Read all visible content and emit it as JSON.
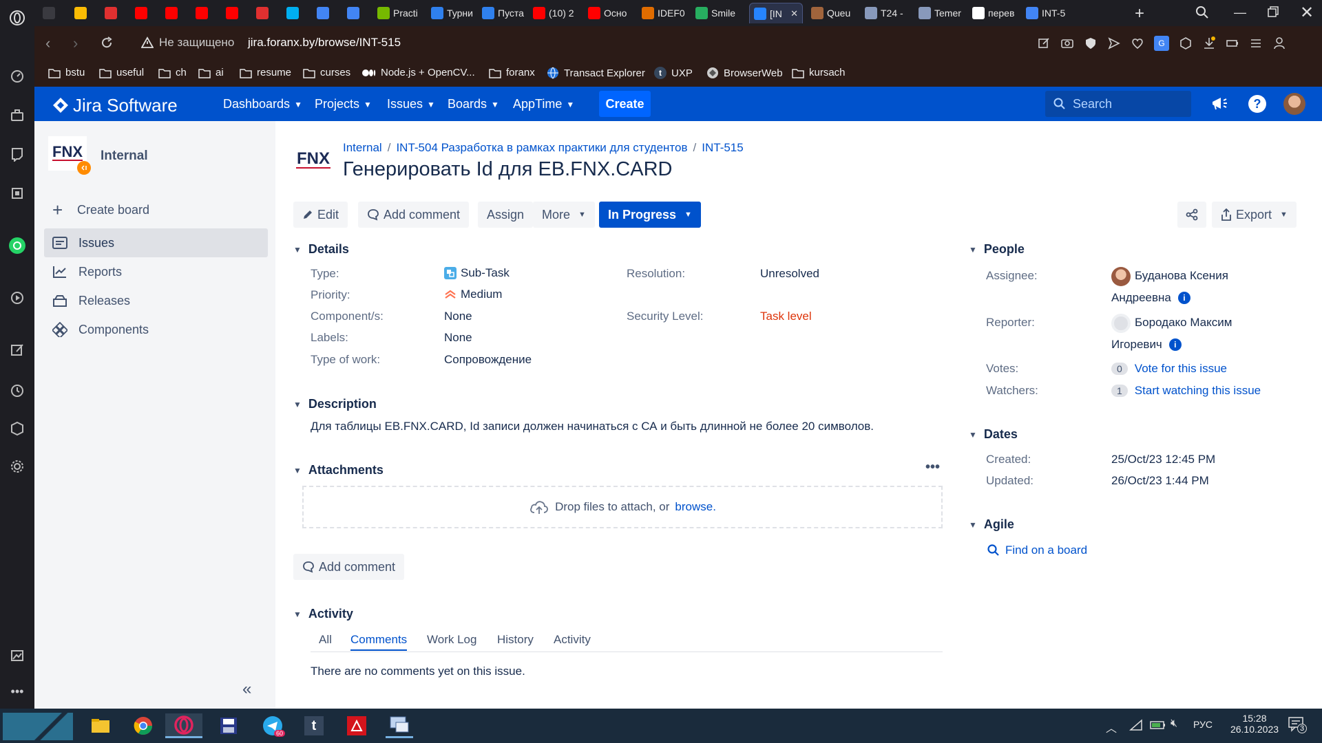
{
  "browser": {
    "tabs": [
      {
        "label": "",
        "icon": "gamepad-icon",
        "color": "#3a3a40"
      },
      {
        "label": "",
        "icon": "google-drive-icon",
        "color": "#fbbc04"
      },
      {
        "label": "",
        "icon": "cherry-icon",
        "color": "#e03030"
      },
      {
        "label": "",
        "icon": "youtube-icon",
        "color": "#ff0000"
      },
      {
        "label": "",
        "icon": "youtube-icon",
        "color": "#ff0000"
      },
      {
        "label": "",
        "icon": "youtube-icon",
        "color": "#ff0000"
      },
      {
        "label": "",
        "icon": "youtube-icon",
        "color": "#ff0000"
      },
      {
        "label": "",
        "icon": "cherry-icon",
        "color": "#e03030"
      },
      {
        "label": "",
        "icon": "skype-icon",
        "color": "#00aff0"
      },
      {
        "label": "",
        "icon": "docs-icon",
        "color": "#4285f4"
      },
      {
        "label": "",
        "icon": "docs-icon",
        "color": "#4285f4"
      },
      {
        "label": "Practi",
        "icon": "nvidia-icon",
        "color": "#76b900"
      },
      {
        "label": "Турни",
        "icon": "l-icon",
        "color": "#2f80ed"
      },
      {
        "label": "Пуста",
        "icon": "l-icon",
        "color": "#2f80ed"
      },
      {
        "label": "(10) 2",
        "icon": "youtube-icon",
        "color": "#ff0000"
      },
      {
        "label": "Осно",
        "icon": "youtube-icon",
        "color": "#ff0000"
      },
      {
        "label": "IDEF0",
        "icon": "idef-icon",
        "color": "#e06c00"
      },
      {
        "label": "Smile",
        "icon": "smile-icon",
        "color": "#27ae60"
      },
      {
        "label": "[IN",
        "icon": "jira-icon",
        "color": "#2684ff"
      },
      {
        "label": "Queu",
        "icon": "avatar-icon",
        "color": "#a0643c"
      },
      {
        "label": "T24 -",
        "icon": "t24-icon",
        "color": "#8899bb"
      },
      {
        "label": "Temer",
        "icon": "t24-icon",
        "color": "#8899bb"
      },
      {
        "label": "перев",
        "icon": "google-icon",
        "color": "#ffffff"
      },
      {
        "label": "INT-5",
        "icon": "docs-icon",
        "color": "#4285f4"
      }
    ],
    "insecure_label": "Не защищено",
    "url": "jira.foranx.by/browse/INT-515",
    "bookmarks": [
      {
        "label": "bstu",
        "icon": "folder-icon"
      },
      {
        "label": "useful",
        "icon": "folder-icon"
      },
      {
        "label": "ch",
        "icon": "folder-icon"
      },
      {
        "label": "ai",
        "icon": "folder-icon"
      },
      {
        "label": "resume",
        "icon": "folder-icon"
      },
      {
        "label": "curses",
        "icon": "folder-icon"
      },
      {
        "label": "Node.js + OpenCV...",
        "icon": "medium-icon"
      },
      {
        "label": "foranx",
        "icon": "folder-icon"
      },
      {
        "label": "Transact Explorer",
        "icon": "globe-icon"
      },
      {
        "label": "UXP",
        "icon": "tumblr-icon"
      },
      {
        "label": "BrowserWeb",
        "icon": "browser-icon"
      },
      {
        "label": "kursach",
        "icon": "folder-icon"
      }
    ]
  },
  "jira": {
    "logo_text": "Jira Software",
    "nav": [
      {
        "label": "Dashboards"
      },
      {
        "label": "Projects"
      },
      {
        "label": "Issues"
      },
      {
        "label": "Boards"
      },
      {
        "label": "AppTime"
      }
    ],
    "create_label": "Create",
    "search_placeholder": "Search",
    "accent": "#0052cc"
  },
  "sidebar": {
    "project_name": "Internal",
    "create_board": "Create board",
    "items": [
      {
        "label": "Issues",
        "icon": "issues-icon",
        "active": true
      },
      {
        "label": "Reports",
        "icon": "reports-icon"
      },
      {
        "label": "Releases",
        "icon": "releases-icon"
      },
      {
        "label": "Components",
        "icon": "components-icon"
      }
    ]
  },
  "issue": {
    "breadcrumbs": [
      "Internal",
      "INT-504 Разработка в рамках практики для студентов",
      "INT-515"
    ],
    "title": "Генерировать Id для EB.FNX.CARD",
    "actions": {
      "edit": "Edit",
      "add_comment": "Add comment",
      "assign": "Assign",
      "more": "More",
      "status": "In Progress",
      "export": "Export"
    },
    "details_title": "Details",
    "details": {
      "type_label": "Type:",
      "type_value": "Sub-Task",
      "priority_label": "Priority:",
      "priority_value": "Medium",
      "components_label": "Component/s:",
      "components_value": "None",
      "labels_label": "Labels:",
      "labels_value": "None",
      "work_label": "Type of work:",
      "work_value": "Сопровождение",
      "resolution_label": "Resolution:",
      "resolution_value": "Unresolved",
      "security_label": "Security Level:",
      "security_value": "Task level"
    },
    "description_title": "Description",
    "description": "Для таблицы EB.FNX.CARD, Id записи должен начинаться с СА и быть длинной не более 20 символов.",
    "attachments_title": "Attachments",
    "drop_text": "Drop files to attach, or",
    "browse": "browse.",
    "add_comment_bottom": "Add comment",
    "activity_title": "Activity",
    "activity_tabs": [
      "All",
      "Comments",
      "Work Log",
      "History",
      "Activity"
    ],
    "no_comments": "There are no comments yet on this issue."
  },
  "people": {
    "title": "People",
    "assignee_label": "Assignee:",
    "assignee_line1": "Буданова Ксения",
    "assignee_line2": "Андреевна",
    "reporter_label": "Reporter:",
    "reporter_line1": "Бородако Максим",
    "reporter_line2": "Игоревич",
    "votes_label": "Votes:",
    "votes_count": "0",
    "votes_link": "Vote for this issue",
    "watchers_label": "Watchers:",
    "watchers_count": "1",
    "watchers_link": "Start watching this issue"
  },
  "dates": {
    "title": "Dates",
    "created_label": "Created:",
    "created_value": "25/Oct/23 12:45 PM",
    "updated_label": "Updated:",
    "updated_value": "26/Oct/23 1:44 PM"
  },
  "agile": {
    "title": "Agile",
    "find_board": "Find on a board"
  },
  "taskbar": {
    "time": "15:28",
    "date": "26.10.2023",
    "lang": "РУС",
    "notif_count": "3",
    "telegram_badge": "60"
  }
}
